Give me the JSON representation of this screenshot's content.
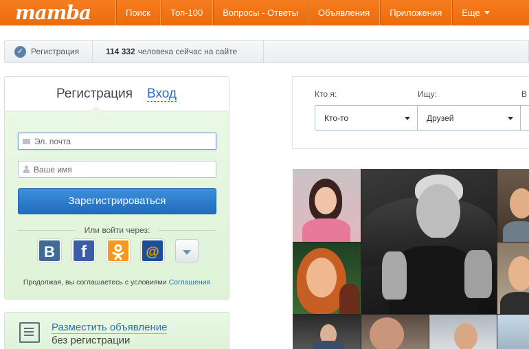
{
  "header": {
    "logo": "mamba",
    "nav": [
      "Поиск",
      "Топ-100",
      "Вопросы - Ответы",
      "Объявления",
      "Приложения",
      "Еще"
    ]
  },
  "statusbar": {
    "registration_label": "Регистрация",
    "online_count": "114 332",
    "online_text": "человека сейчас на сайте"
  },
  "register_panel": {
    "tab_register": "Регистрация",
    "tab_login": "Вход",
    "email_placeholder": "Эл. почта",
    "name_placeholder": "Ваше имя",
    "submit_label": "Зарегистрироваться",
    "or_login_with": "Или войти через:",
    "socials": {
      "vk": "B",
      "facebook": "f",
      "odnoklassniki": "ok-icon",
      "mailru": "@",
      "more": "chevron-down-icon"
    },
    "terms_text": "Продолжая, вы соглашаетесь с условиями",
    "terms_link": "Соглашения"
  },
  "ad_panel": {
    "link": "Разместить объявление",
    "subtitle": "без регистрации"
  },
  "search": {
    "who_label": "Кто я:",
    "seek_label": "Ищу:",
    "third_label": "В",
    "who_value": "Кто-то",
    "seek_value": "Друзей"
  },
  "colors": {
    "brand_orange": "#f07316",
    "button_blue": "#2a78cc",
    "link_blue": "#2a6ebb",
    "panel_green": "#e4f6dd"
  }
}
